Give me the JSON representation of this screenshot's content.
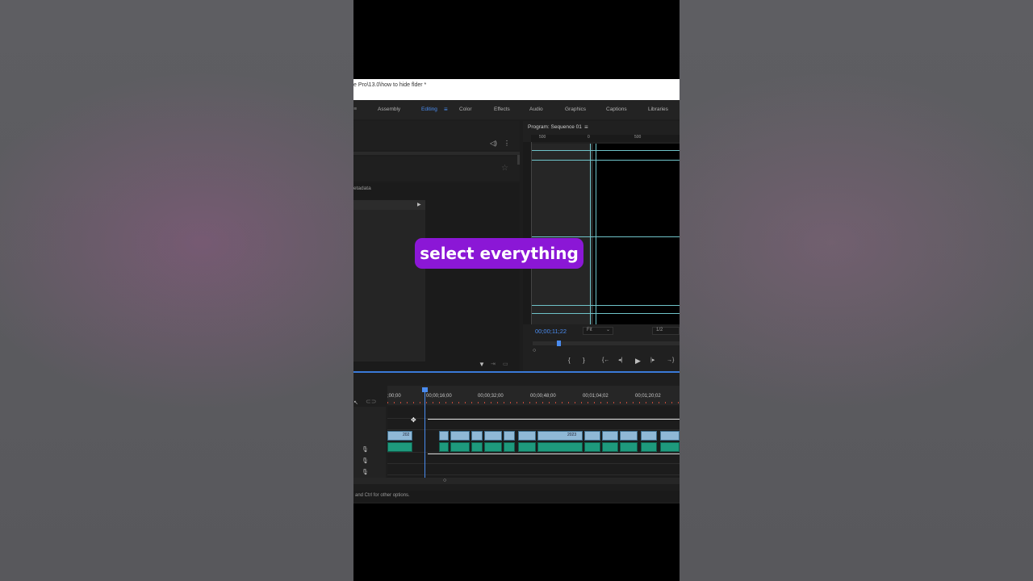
{
  "window": {
    "title": "e Pro\\13.0\\how to hide flder *"
  },
  "workspaces": [
    {
      "label": "Assembly"
    },
    {
      "label": "Editing",
      "active": true
    },
    {
      "label": "Color"
    },
    {
      "label": "Effects"
    },
    {
      "label": "Audio"
    },
    {
      "label": "Graphics"
    },
    {
      "label": "Captions"
    },
    {
      "label": "Libraries"
    }
  ],
  "workspace_menu_icon": "hamburger-icon",
  "left_panel": {
    "metadata_tab": "etadata"
  },
  "program_monitor": {
    "title": "Program: Sequence 01",
    "ruler_labels": [
      "500",
      "0",
      "500"
    ],
    "timecode": "00;00;11;22",
    "fit": "Fit",
    "resolution": "1/2"
  },
  "timeline": {
    "ruler_labels": [
      ";00;00",
      "00;00;16;00",
      "00;00;32;00",
      "00;00;48;00",
      "00;01;04;02",
      "00;01;20;02"
    ],
    "clip_labels": [
      "202",
      "2023"
    ]
  },
  "status_bar": {
    "text": "and Ctrl for other options."
  },
  "overlay_caption": {
    "text": "select everything"
  },
  "colors": {
    "accent": "#4a8cf0",
    "caption_bg": "#8b17d6",
    "video_clip": "#8fb8d6",
    "audio_clip": "#1e9a7d",
    "guide_line": "#6fc3c9"
  }
}
